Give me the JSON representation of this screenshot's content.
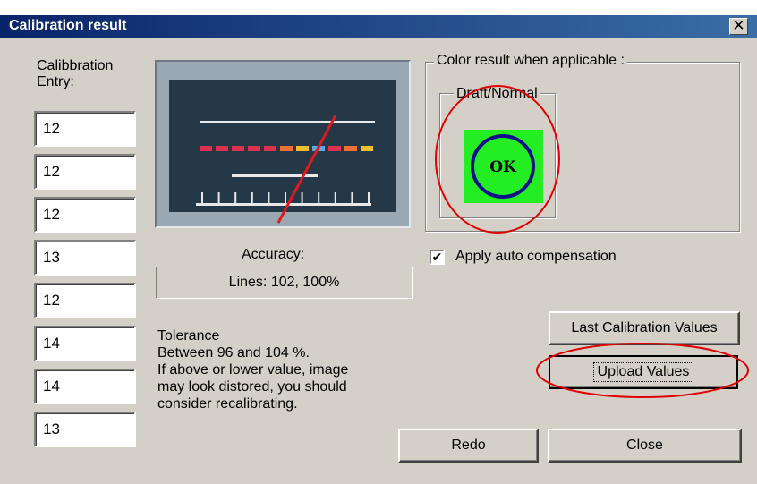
{
  "window": {
    "title": "Calibration result",
    "close_glyph": "✕"
  },
  "calibration": {
    "label_line1": "Calibbration",
    "label_line2": "Entry:",
    "entries": [
      "12",
      "12",
      "12",
      "13",
      "12",
      "14",
      "14",
      "13"
    ]
  },
  "gauge": {
    "ticks_count": 11,
    "segments": [
      "#e03050",
      "#e03050",
      "#e03050",
      "#e03050",
      "#e03050",
      "#f07038",
      "#f0c030",
      "#60a8e0",
      "#e03050",
      "#f07038",
      "#f0c030"
    ],
    "needle_color": "#e01820"
  },
  "accuracy": {
    "label": "Accuracy:",
    "readout": "Lines: 102,    100%"
  },
  "tolerance": {
    "lines": [
      "Tolerance",
      "Between 96 and 104 %.",
      "If above or lower value, image",
      "may look distored, you should",
      "consider recalibrating."
    ]
  },
  "color_result": {
    "caption": "Color result when applicable :",
    "draft_caption": "Draft/Normal",
    "status_text": "OK",
    "status_bg": "#22ee22",
    "ring_color": "#10108a"
  },
  "auto_compensation": {
    "label": "Apply auto compensation",
    "checked": true,
    "check_glyph": "✔"
  },
  "buttons": {
    "last_calibration": "Last Calibration Values",
    "upload": "Upload Values",
    "redo": "Redo",
    "close": "Close"
  },
  "colors": {
    "dialog_bg": "#d4d0c8",
    "titlebar_start": "#0a246a",
    "titlebar_end": "#3a6ea5",
    "annotation_red": "#e00000"
  }
}
